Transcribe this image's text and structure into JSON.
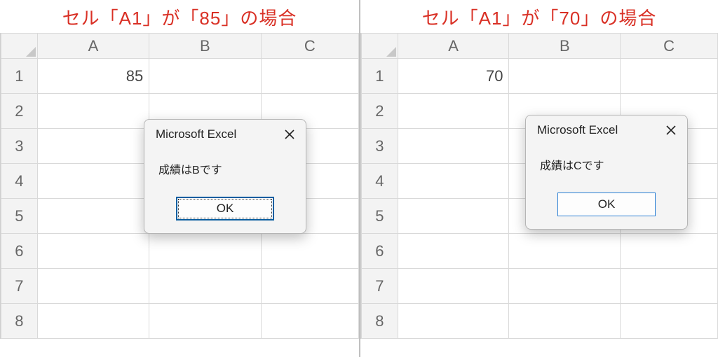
{
  "left": {
    "caption": "セル「A1」が「85」の場合",
    "columns": [
      "A",
      "B",
      "C"
    ],
    "rows": [
      "1",
      "2",
      "3",
      "4",
      "5",
      "6",
      "7",
      "8"
    ],
    "cells": {
      "A1": "85"
    },
    "dialog": {
      "title": "Microsoft Excel",
      "message": "成績はBです",
      "ok_label": "OK",
      "ok_state": "focused"
    }
  },
  "right": {
    "caption": "セル「A1」が「70」の場合",
    "columns": [
      "A",
      "B",
      "C"
    ],
    "rows": [
      "1",
      "2",
      "3",
      "4",
      "5",
      "6",
      "7",
      "8"
    ],
    "cells": {
      "A1": "70"
    },
    "dialog": {
      "title": "Microsoft Excel",
      "message": "成績はCです",
      "ok_label": "OK",
      "ok_state": "plain"
    }
  }
}
